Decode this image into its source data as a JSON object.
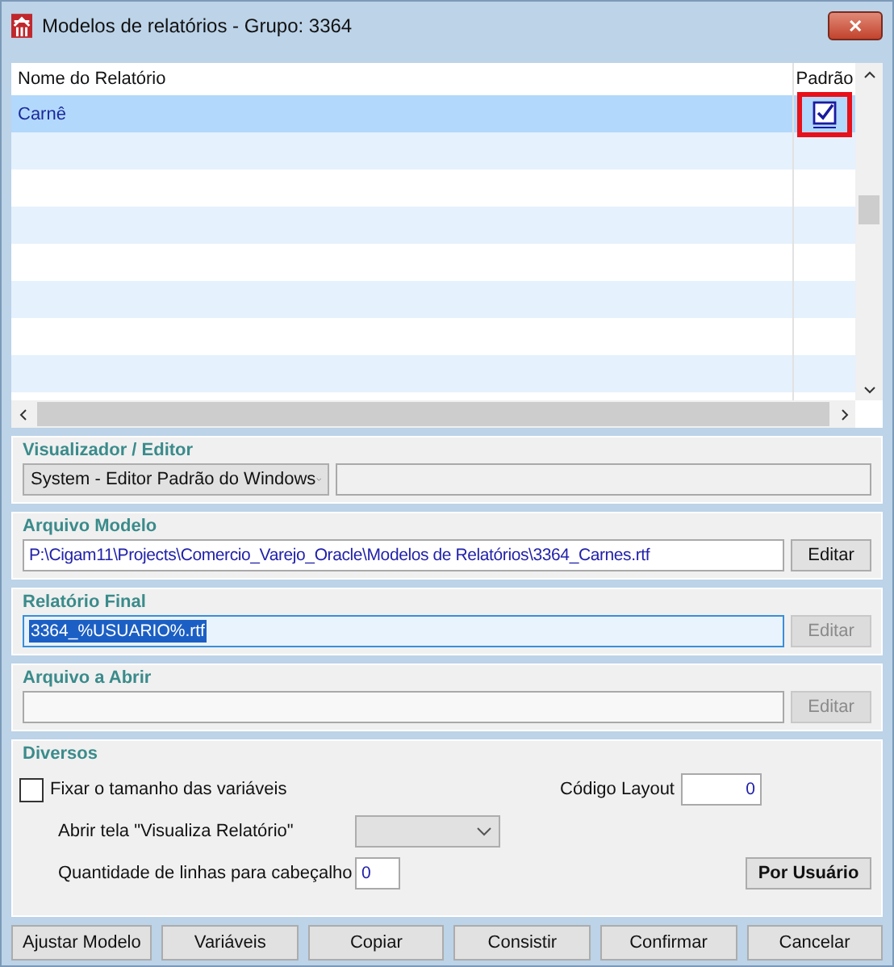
{
  "window": {
    "title": "Modelos de relatórios - Grupo: 3364",
    "close": "✕"
  },
  "grid": {
    "columns": [
      "Nome do Relatório",
      "Padrão"
    ],
    "rows": [
      {
        "name": "Carnê",
        "default": true,
        "selected": true,
        "highlighted": true
      }
    ]
  },
  "viewer": {
    "legend": "Visualizador / Editor",
    "value": "System - Editor Padrão do Windows"
  },
  "model_file": {
    "legend": "Arquivo Modelo",
    "value": "P:\\Cigam11\\Projects\\Comercio_Varejo_Oracle\\Modelos de Relatórios\\3364_Carnes.rtf",
    "button": "Editar",
    "disabled": false
  },
  "final_report": {
    "legend": "Relatório Final",
    "value": "3364_%USUARIO%.rtf",
    "button": "Editar",
    "disabled": true
  },
  "open_file": {
    "legend": "Arquivo a Abrir",
    "button": "Editar",
    "disabled": true
  },
  "misc": {
    "legend": "Diversos",
    "fix_size": {
      "label": "Fixar o tamanho das variáveis",
      "checked": false
    },
    "layout_code": {
      "label": "Código Layout",
      "value": "0"
    },
    "open_view": {
      "label": "Abrir tela \"Visualiza Relatório\""
    },
    "header_lines": {
      "label": "Quantidade de linhas para cabeçalho",
      "value": "0"
    },
    "per_user": "Por Usuário"
  },
  "buttons": [
    "Ajustar Modelo",
    "Variáveis",
    "Copiar",
    "Consistir",
    "Confirmar",
    "Cancelar"
  ]
}
